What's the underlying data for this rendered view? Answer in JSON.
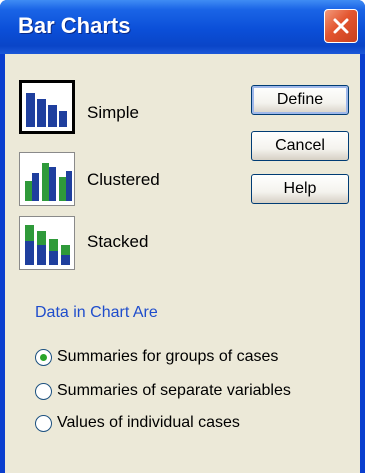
{
  "window": {
    "title": "Bar Charts"
  },
  "chart_types": [
    {
      "label": "Simple",
      "selected": true
    },
    {
      "label": "Clustered",
      "selected": false
    },
    {
      "label": "Stacked",
      "selected": false
    }
  ],
  "buttons": {
    "define": "Define",
    "cancel": "Cancel",
    "help": "Help"
  },
  "data_group": {
    "title": "Data in Chart Are",
    "options": [
      {
        "label": "Summaries for groups of cases",
        "checked": true
      },
      {
        "label": "Summaries of separate variables",
        "checked": false
      },
      {
        "label": "Values of individual cases",
        "checked": false
      }
    ]
  },
  "colors": {
    "titlebar": "#0b4fd8",
    "bar_blue": "#1f3f9e",
    "bar_green": "#2f9a3a",
    "radio_dot": "#2aa52a",
    "group_title": "#1f4dcc"
  }
}
